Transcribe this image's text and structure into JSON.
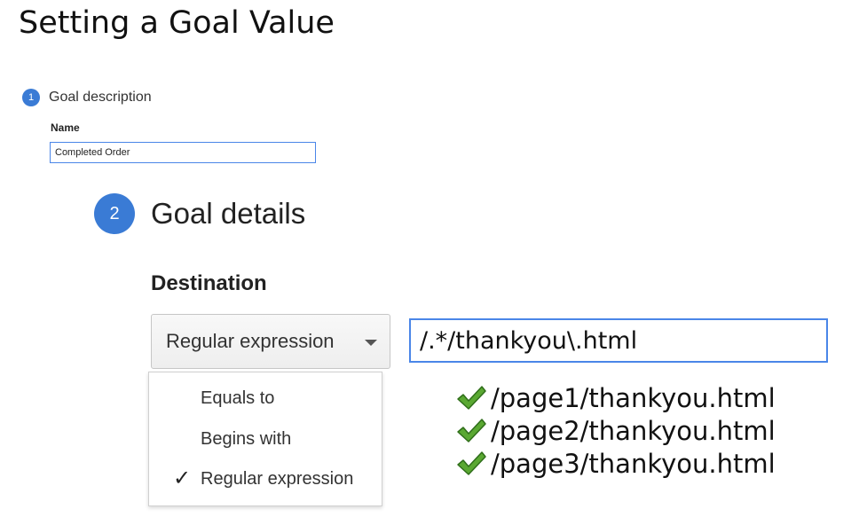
{
  "slide": {
    "title": "Setting a Goal Value"
  },
  "goal_description": {
    "step_number": "1",
    "label": "Goal description",
    "name_label": "Name",
    "name_value": "Completed Order"
  },
  "goal_details": {
    "step_number": "2",
    "label": "Goal details",
    "destination_label": "Destination",
    "match_type_selected": "Regular expression",
    "match_type_options": [
      {
        "label": "Equals to",
        "checked": false
      },
      {
        "label": "Begins with",
        "checked": false
      },
      {
        "label": "Regular expression",
        "checked": true
      }
    ],
    "check_glyph": "✓",
    "destination_value": "/.*/thankyou\\.html"
  },
  "matching_pages": [
    {
      "url": "/page1/thankyou.html",
      "icon": "green-check-icon"
    },
    {
      "url": "/page2/thankyou.html",
      "icon": "green-check-icon"
    },
    {
      "url": "/page3/thankyou.html",
      "icon": "green-check-icon"
    }
  ],
  "colors": {
    "accent_blue": "#3a7bd5",
    "input_border": "#4a86e8",
    "check_green": "#4caf50"
  }
}
